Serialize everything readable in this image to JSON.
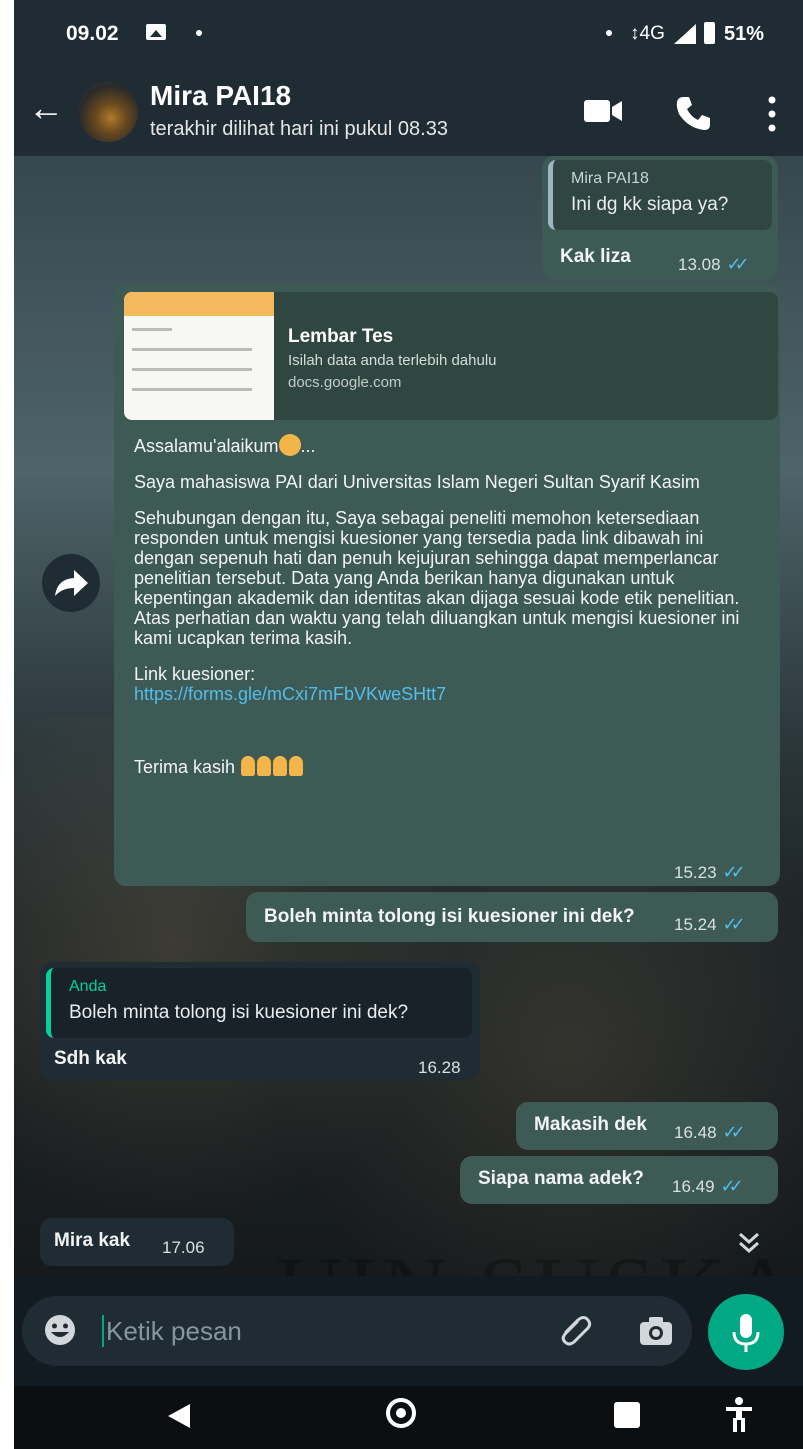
{
  "status_bar": {
    "time": "09.02",
    "network": "↕4G",
    "battery": "51%"
  },
  "header": {
    "contact_name": "Mira PAI18",
    "last_seen": "terakhir dilihat hari ini pukul 08.33"
  },
  "messages": [
    {
      "direction": "outgoing",
      "quote_author": "Mira PAI18",
      "quote_text": "Ini dg kk siapa ya?",
      "text": "Kak liza",
      "time": "13.08",
      "status": "read"
    },
    {
      "direction": "outgoing",
      "preview_title": "Lembar Tes",
      "preview_description": "Isilah data anda terlebih dahulu",
      "preview_url": "docs.google.com",
      "greeting": "Assalamu'alaikum",
      "greeting_suffix": "...",
      "para1": "Saya mahasiswa PAI dari Universitas Islam Negeri Sultan Syarif Kasim",
      "para2": "Sehubungan dengan itu, Saya sebagai peneliti memohon ketersediaan responden untuk mengisi kuesioner yang tersedia pada link dibawah ini dengan sepenuh hati dan penuh kejujuran sehingga dapat memperlancar penelitian tersebut. Data yang Anda berikan hanya digunakan untuk kepentingan akademik dan identitas akan dijaga sesuai kode etik penelitian. Atas perhatian dan waktu yang telah diluangkan untuk mengisi kuesioner ini kami ucapkan terima kasih.",
      "link_label": "Link kuesioner:",
      "link_url": "https://forms.gle/mCxi7mFbVKweSHtt7",
      "closing": "Terima kasih",
      "time": "15.23",
      "status": "read"
    },
    {
      "direction": "outgoing",
      "text": "Boleh minta tolong isi kuesioner ini dek?",
      "time": "15.24",
      "status": "read"
    },
    {
      "direction": "incoming",
      "quote_author": "Anda",
      "quote_text": "Boleh minta tolong isi kuesioner ini dek?",
      "text": "Sdh kak",
      "time": "16.28"
    },
    {
      "direction": "outgoing",
      "text": "Makasih dek",
      "time": "16.48",
      "status": "read"
    },
    {
      "direction": "outgoing",
      "text": "Siapa nama adek?",
      "time": "16.49",
      "status": "read"
    },
    {
      "direction": "incoming",
      "text": "Mira kak",
      "time": "17.06"
    }
  ],
  "wallpaper_watermark": "UIN SUSKA",
  "input": {
    "placeholder": "Ketik pesan"
  },
  "colors": {
    "header_bg": "#1f2c34",
    "outgoing_bubble": "#3d5a55",
    "incoming_bubble": "#1f2c34",
    "read_tick": "#53bdeb",
    "accent": "#00a884"
  },
  "icons": {
    "back": "arrow-left-icon",
    "video": "video-camera-icon",
    "call": "phone-icon",
    "menu": "kebab-menu-icon",
    "forward": "forward-icon",
    "scroll": "chevron-double-down-icon",
    "emoji": "emoji-icon",
    "attach": "paperclip-icon",
    "camera": "camera-icon",
    "mic": "microphone-icon"
  }
}
